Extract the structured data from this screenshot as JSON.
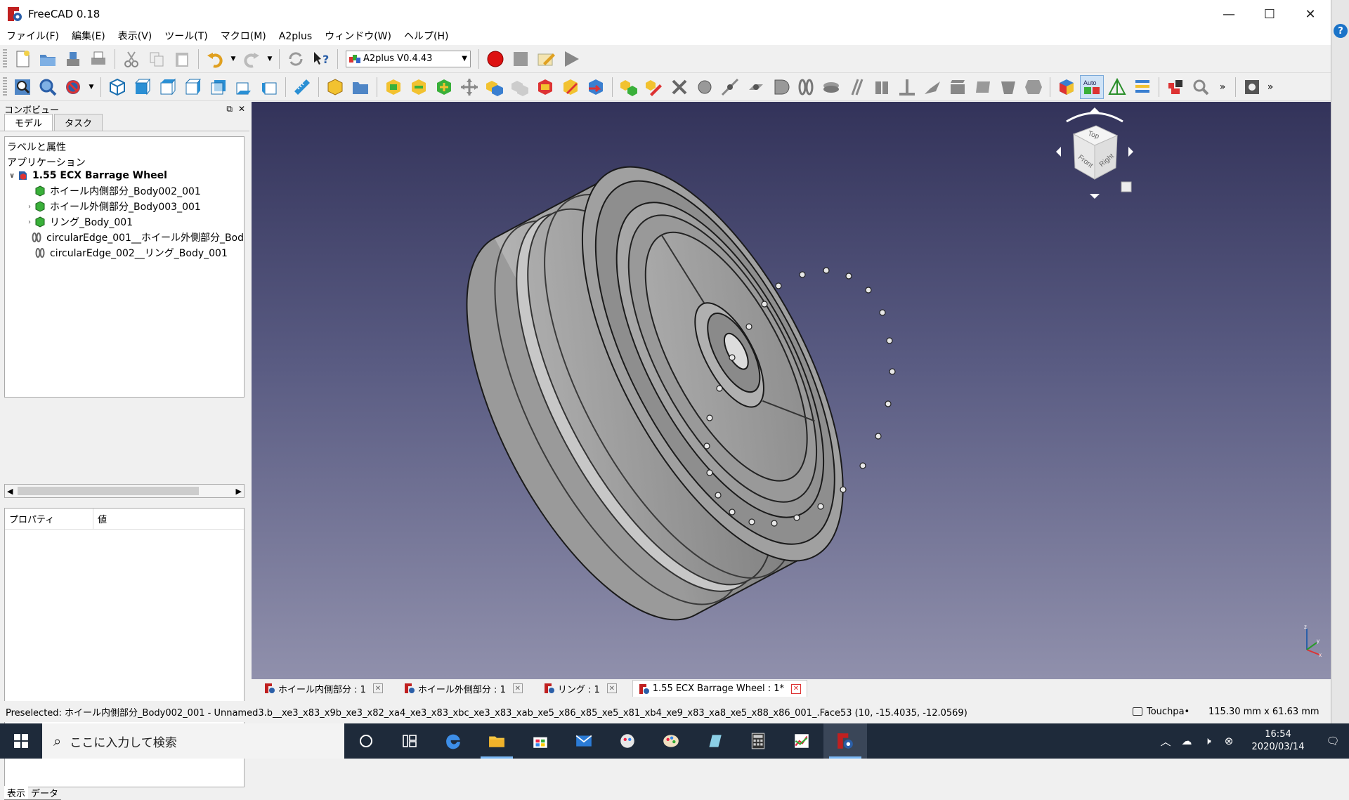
{
  "app": {
    "title": "FreeCAD 0.18",
    "window_controls": [
      "—",
      "☐",
      "✕"
    ]
  },
  "menu": [
    "ファイル(F)",
    "編集(E)",
    "表示(V)",
    "ツール(T)",
    "マクロ(M)",
    "A2plus",
    "ウィンドウ(W)",
    "ヘルプ(H)"
  ],
  "toolbar": {
    "workbench": "A2plus V0.4.43",
    "auto_label": "Auto",
    "more": "»"
  },
  "combo": {
    "title": "コンボビュー",
    "tabs": [
      "モデル",
      "タスク"
    ],
    "section_label": "ラベルと属性",
    "app_label": "アプリケーション",
    "tree": [
      {
        "label": "1.55 ECX Barrage Wheel",
        "level": 0,
        "arrow": "∨",
        "icon": "document-icon"
      },
      {
        "label": "ホイール内側部分_Body002_001",
        "level": 1,
        "arrow": "",
        "icon": "part-icon"
      },
      {
        "label": "ホイール外側部分_Body003_001",
        "level": 1,
        "arrow": "›",
        "icon": "part-icon"
      },
      {
        "label": "リング_Body_001",
        "level": 1,
        "arrow": "›",
        "icon": "part-icon"
      },
      {
        "label": "circularEdge_001__ホイール外側部分_Bod",
        "level": 1,
        "arrow": "",
        "icon": "constraint-icon"
      },
      {
        "label": "circularEdge_002__リング_Body_001",
        "level": 1,
        "arrow": "",
        "icon": "constraint-icon"
      }
    ],
    "prop_headers": [
      "プロパティ",
      "値"
    ],
    "bottom_tabs": [
      "表示",
      "データ"
    ]
  },
  "navcube": {
    "top": "Top",
    "front": "Front",
    "right": "Right"
  },
  "axes": {
    "x": "x",
    "y": "y",
    "z": "z"
  },
  "doc_tabs": [
    {
      "label": "ホイール内側部分 : 1",
      "active": false
    },
    {
      "label": "ホイール外側部分 : 1",
      "active": false
    },
    {
      "label": "リング : 1",
      "active": false
    },
    {
      "label": "1.55 ECX Barrage Wheel : 1*",
      "active": true
    }
  ],
  "status": {
    "message": "Preselected: ホイール内側部分_Body002_001 - Unnamed3.b__xe3_x83_x9b_xe3_x82_xa4_xe3_x83_xbc_xe3_x83_xab_xe5_x86_x85_xe5_x81_xb4_xe9_x83_xa8_xe5_x88_x86_001_.Face53 (10, -15.4035, -12.0569)",
    "navigation": "Touchpa•",
    "dimensions": "115.30 mm x 61.63 mm"
  },
  "taskbar": {
    "search_placeholder": "ここに入力して検索",
    "time": "16:54",
    "date": "2020/03/14"
  },
  "colors": {
    "accent": "#1a73c8",
    "record": "#dd1111",
    "view_top": "#33335a",
    "view_bottom": "#9090ac"
  }
}
